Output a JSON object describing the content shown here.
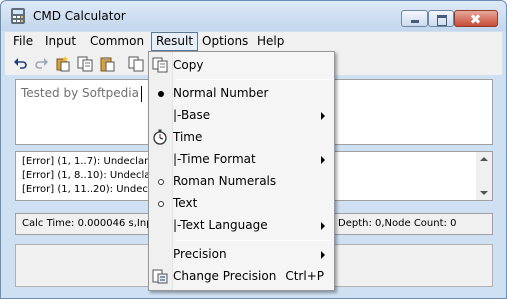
{
  "window": {
    "title": "CMD Calculator"
  },
  "menubar": {
    "items": [
      {
        "label": "File"
      },
      {
        "label": "Input"
      },
      {
        "label": "Common"
      },
      {
        "label": "Result"
      },
      {
        "label": "Options"
      },
      {
        "label": "Help"
      }
    ]
  },
  "editor": {
    "text": "Tested by Softpedia"
  },
  "errors": {
    "lines": [
      "[Error] (1, 1..7): Undeclare",
      "[Error] (1, 8..10): Undecla",
      "[Error] (1, 11..20): Undecl"
    ]
  },
  "status": {
    "left": "Calc Time: 0.000046 s,Inp",
    "right": "Depth: 0,Node Count: 0"
  },
  "result_menu": {
    "copy": "Copy",
    "normal_number": "Normal Number",
    "base": "|-Base",
    "time": "Time",
    "time_format": "|-Time Format",
    "roman_numerals": "Roman Numerals",
    "text": "Text",
    "text_language": "|-Text Language",
    "precision": "Precision",
    "change_precision": "Change Precision",
    "change_precision_shortcut": "Ctrl+P"
  },
  "colors": {
    "titlebar": "#cfe0f2",
    "close_button": "#c64c36",
    "menu_background": "#f5f5f5"
  }
}
